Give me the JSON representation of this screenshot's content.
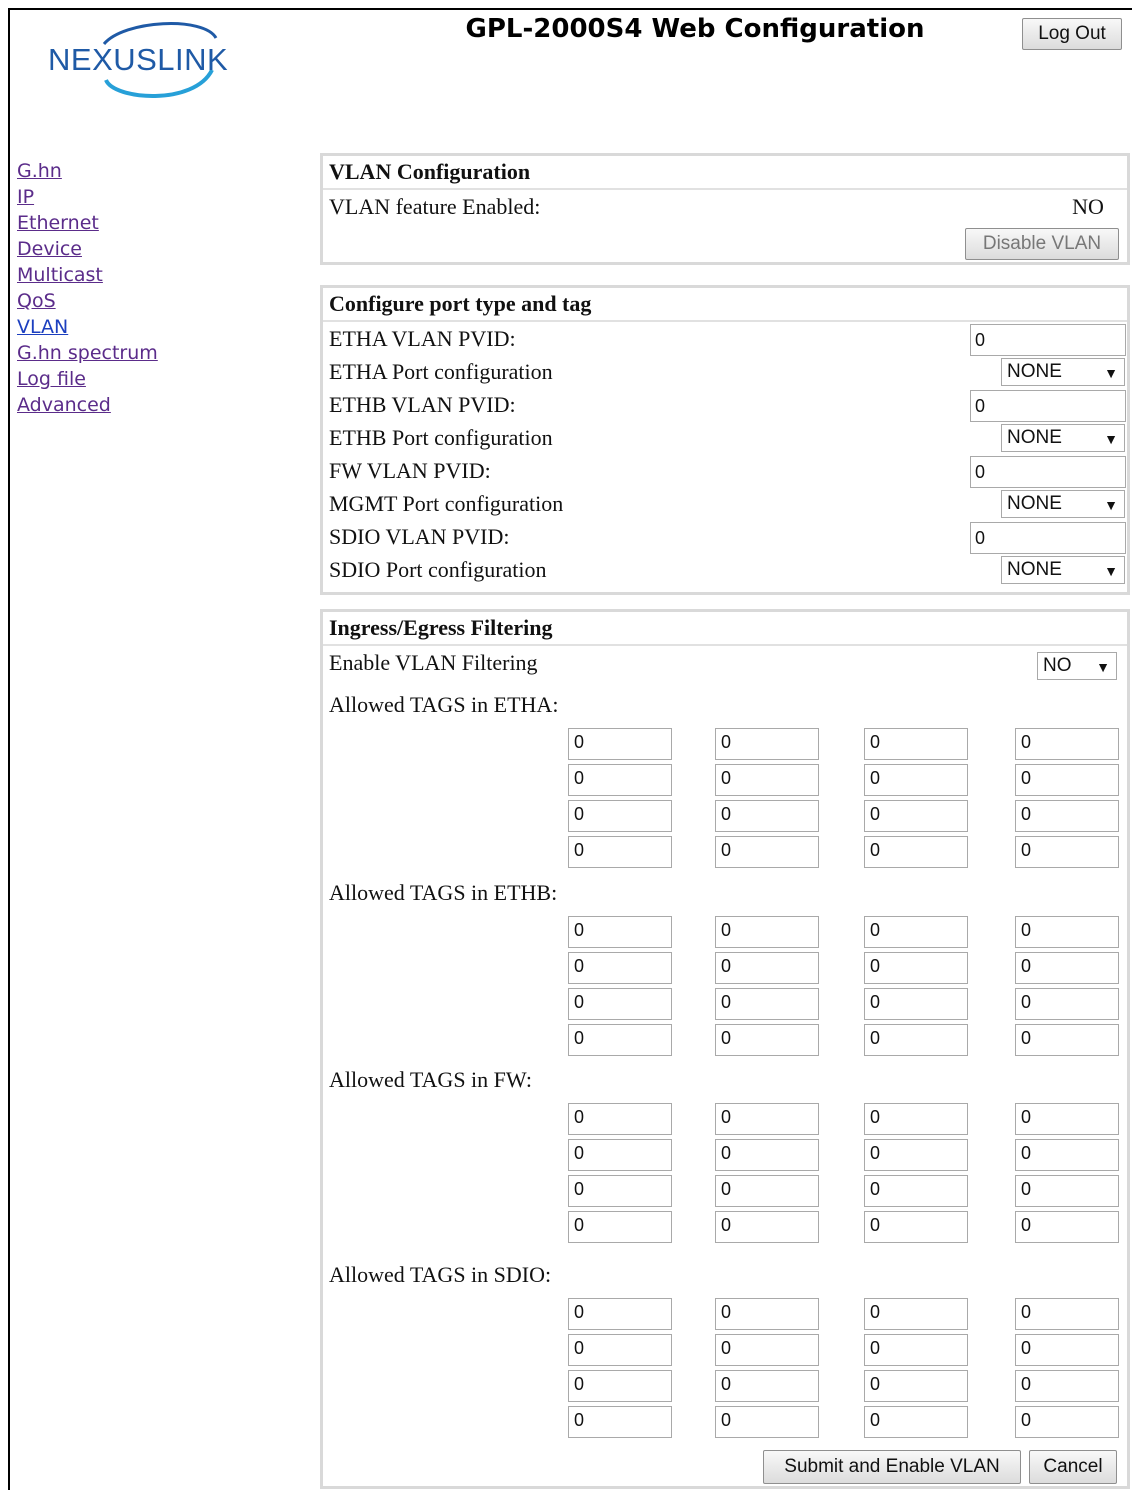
{
  "header": {
    "logo_text": "NEXUSLINK",
    "title": "GPL-2000S4 Web Configuration",
    "logout_label": "Log Out"
  },
  "nav": {
    "items": [
      {
        "label": "G.hn"
      },
      {
        "label": "IP"
      },
      {
        "label": "Ethernet"
      },
      {
        "label": "Device"
      },
      {
        "label": "Multicast"
      },
      {
        "label": "QoS"
      },
      {
        "label": "VLAN"
      },
      {
        "label": "G.hn spectrum"
      },
      {
        "label": "Log file"
      },
      {
        "label": "Advanced"
      }
    ]
  },
  "vlan_config": {
    "title": "VLAN Configuration",
    "enabled_label": "VLAN feature Enabled:",
    "enabled_value": "NO",
    "disable_button": "Disable VLAN"
  },
  "port_config": {
    "title": "Configure port type and tag",
    "rows": [
      {
        "label": "ETHA VLAN PVID:",
        "type": "input",
        "value": "0"
      },
      {
        "label": "ETHA Port configuration",
        "type": "select",
        "value": "NONE"
      },
      {
        "label": "ETHB VLAN PVID:",
        "type": "input",
        "value": "0"
      },
      {
        "label": "ETHB Port configuration",
        "type": "select",
        "value": "NONE"
      },
      {
        "label": "FW VLAN PVID:",
        "type": "input",
        "value": "0"
      },
      {
        "label": "MGMT Port configuration",
        "type": "select",
        "value": "NONE"
      },
      {
        "label": "SDIO VLAN PVID:",
        "type": "input",
        "value": "0"
      },
      {
        "label": "SDIO Port configuration",
        "type": "select",
        "value": "NONE"
      }
    ],
    "select_arrow": "▼"
  },
  "filtering": {
    "title": "Ingress/Egress Filtering",
    "enable_label": "Enable VLAN Filtering",
    "enable_value": "NO",
    "tag_groups": [
      {
        "label": "Allowed TAGS in ETHA:",
        "values": [
          "0",
          "0",
          "0",
          "0",
          "0",
          "0",
          "0",
          "0",
          "0",
          "0",
          "0",
          "0",
          "0",
          "0",
          "0",
          "0"
        ]
      },
      {
        "label": "Allowed TAGS in ETHB:",
        "values": [
          "0",
          "0",
          "0",
          "0",
          "0",
          "0",
          "0",
          "0",
          "0",
          "0",
          "0",
          "0",
          "0",
          "0",
          "0",
          "0"
        ]
      },
      {
        "label": "Allowed TAGS in FW:",
        "values": [
          "0",
          "0",
          "0",
          "0",
          "0",
          "0",
          "0",
          "0",
          "0",
          "0",
          "0",
          "0",
          "0",
          "0",
          "0",
          "0"
        ]
      },
      {
        "label": "Allowed TAGS in SDIO:",
        "values": [
          "0",
          "0",
          "0",
          "0",
          "0",
          "0",
          "0",
          "0",
          "0",
          "0",
          "0",
          "0",
          "0",
          "0",
          "0",
          "0"
        ]
      }
    ],
    "submit_label": "Submit and Enable VLAN",
    "cancel_label": "Cancel"
  }
}
